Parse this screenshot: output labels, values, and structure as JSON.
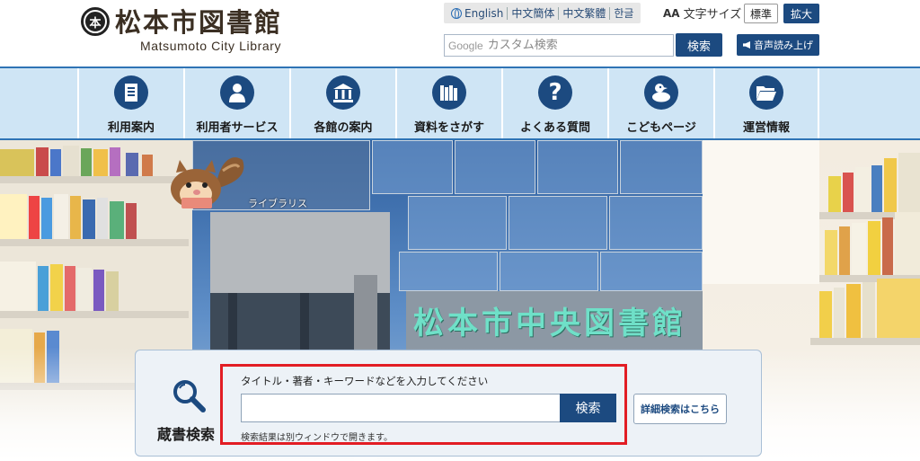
{
  "header": {
    "logo_mark": "本",
    "title": "松本市図書館",
    "subtitle": "Matsumoto City Library"
  },
  "languages": [
    "English",
    "中文簡体",
    "中文繁體",
    "한글"
  ],
  "font_size": {
    "label": "文字サイズ",
    "standard": "標準",
    "large": "拡大"
  },
  "site_search": {
    "logo": "Google",
    "placeholder": "カスタム検索",
    "button": "検索"
  },
  "tts_button": "音声読み上げ",
  "nav": [
    {
      "label": "利用案内",
      "icon": "document-icon"
    },
    {
      "label": "利用者サービス",
      "icon": "person-icon"
    },
    {
      "label": "各館の案内",
      "icon": "building-icon"
    },
    {
      "label": "資料をさがす",
      "icon": "books-icon"
    },
    {
      "label": "よくある質問",
      "icon": "question-icon"
    },
    {
      "label": "こどもページ",
      "icon": "duck-icon"
    },
    {
      "label": "運営情報",
      "icon": "folder-icon"
    }
  ],
  "hero": {
    "sign": "松本市中央図書館",
    "brand_label": "ライブラリス"
  },
  "catalog_search": {
    "title": "蔵書検索",
    "hint": "タイトル・著者・キーワードなどを入力してください",
    "input_value": "",
    "button": "検索",
    "note": "検索結果は別ウィンドウで開きます。",
    "advanced": "詳細検索はこちら"
  },
  "colors": {
    "primary": "#1c4a80",
    "nav_bg": "#cfe5f5",
    "nav_border": "#2f74b5",
    "highlight": "#e21d24"
  }
}
